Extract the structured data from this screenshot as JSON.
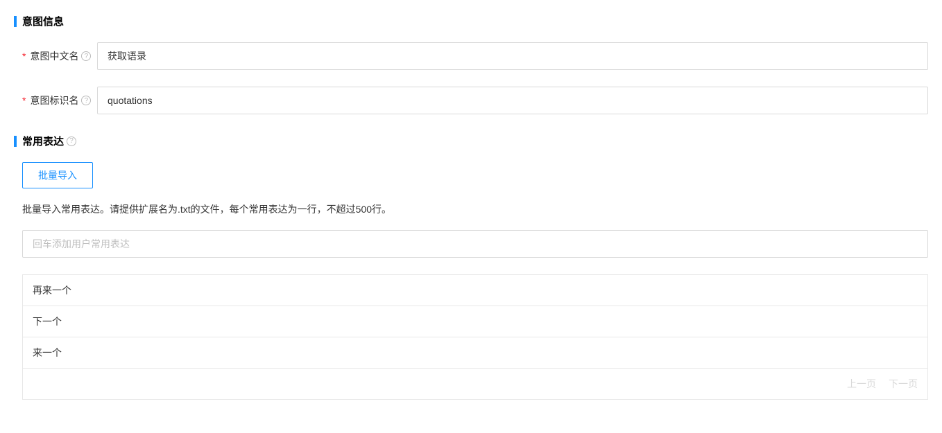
{
  "intent_section": {
    "title": "意图信息",
    "fields": {
      "chinese_name": {
        "label": "意图中文名",
        "value": "获取语录"
      },
      "identifier": {
        "label": "意图标识名",
        "value": "quotations"
      }
    }
  },
  "expressions_section": {
    "title": "常用表达",
    "import_button": "批量导入",
    "import_hint": "批量导入常用表达。请提供扩展名为.txt的文件，每个常用表达为一行，不超过500行。",
    "input_placeholder": "回车添加用户常用表达",
    "items": [
      "再来一个",
      "下一个",
      "来一个"
    ],
    "pagination": {
      "prev": "上一页",
      "next": "下一页"
    }
  }
}
